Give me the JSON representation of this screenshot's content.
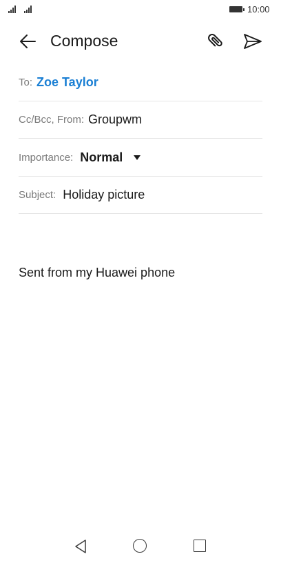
{
  "status_bar": {
    "time": "10:00"
  },
  "app_bar": {
    "title": "Compose",
    "icons": {
      "back": "arrow-left-icon",
      "attach": "paperclip-icon",
      "send": "send-icon"
    }
  },
  "fields": {
    "to": {
      "label": "To:",
      "recipient": "Zoe Taylor"
    },
    "cc_from": {
      "label": "Cc/Bcc, From:",
      "value": "Groupwm"
    },
    "importance": {
      "label": "Importance:",
      "value": "Normal"
    },
    "subject": {
      "label": "Subject:",
      "value": "Holiday picture"
    }
  },
  "body": {
    "signature": "Sent from my Huawei phone"
  },
  "colors": {
    "accent": "#1a7fd4",
    "divider": "#e4e4e4",
    "label": "#7a7a7a",
    "text": "#1a1a1a"
  }
}
